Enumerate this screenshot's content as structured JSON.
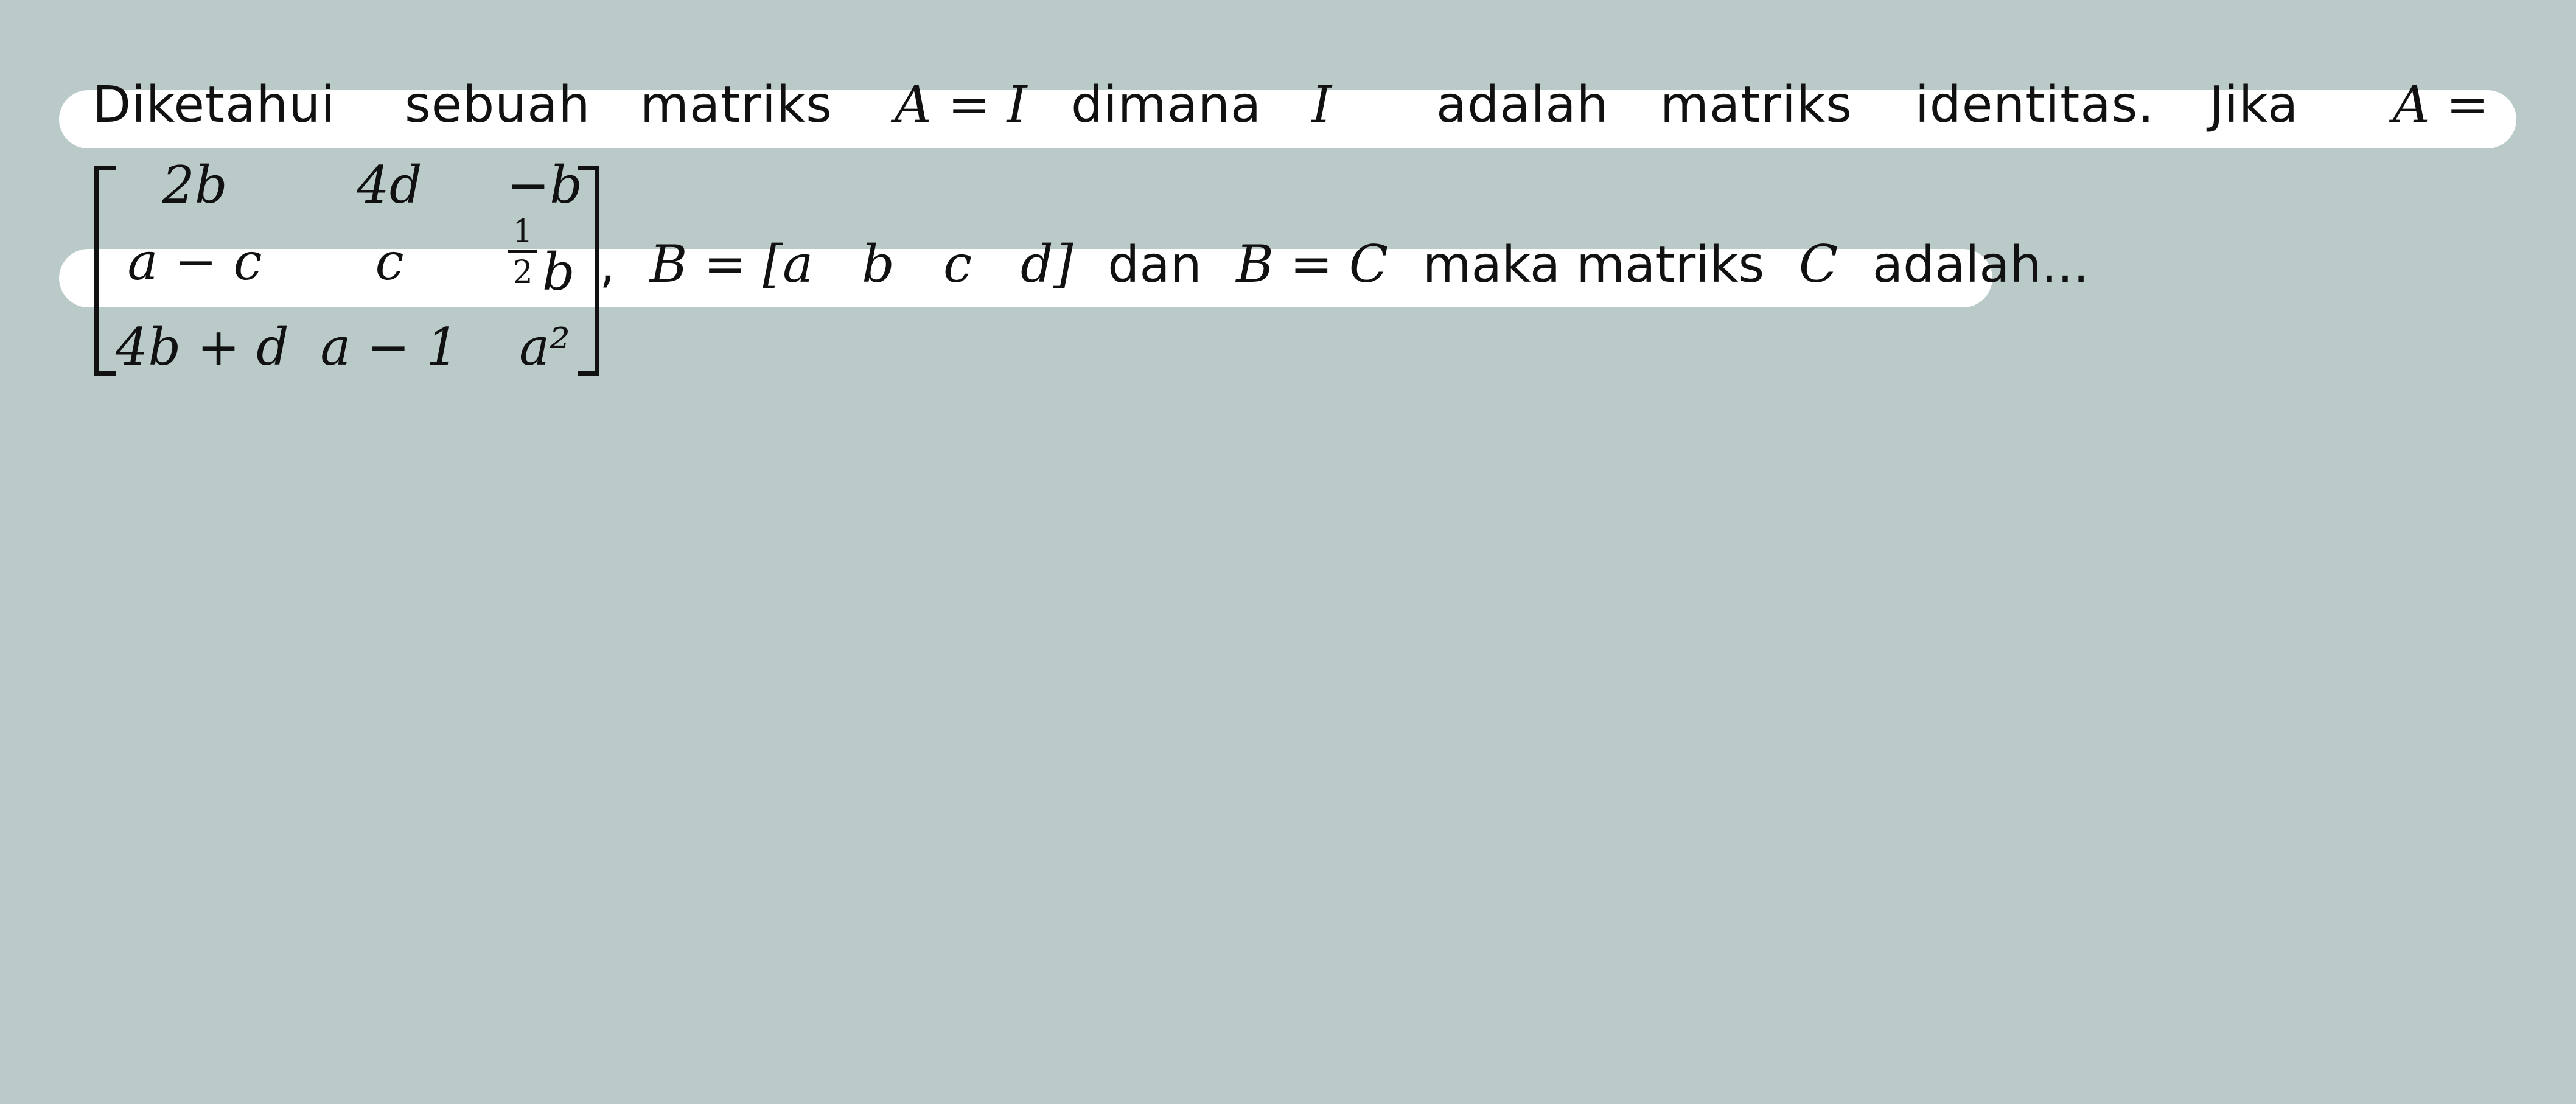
{
  "line1": {
    "diketahui": "Diketahui",
    "sebuah": "sebuah",
    "matriks": "matriks",
    "A_eq_I": "A = I",
    "dimana": "dimana",
    "I": "I",
    "adalah": "adalah",
    "matriks2": "matriks",
    "identitas": "identitas.",
    "jika": "Jika",
    "A_eq": "A ="
  },
  "matrix_A": {
    "r0": [
      "2b",
      "4d",
      "−b"
    ],
    "r1": [
      "a − c",
      "c",
      "b"
    ],
    "r1_fraction": {
      "numerator": "1",
      "denominator": "2"
    },
    "r2": [
      "4b + d",
      "a − 1",
      "a²"
    ]
  },
  "line2": {
    "comma": ",",
    "B_eq": "B =",
    "open_bracket": "[",
    "B_entries": [
      "a",
      "b",
      "c",
      "d"
    ],
    "close_bracket": "]",
    "dan": "dan",
    "B_eq_C": "B = C",
    "maka_matriks": "maka matriks",
    "C": "C",
    "adalah": "adalah..."
  },
  "colors": {
    "background": "#b9cac9",
    "highlight": "#ffffff",
    "text": "#111111"
  }
}
